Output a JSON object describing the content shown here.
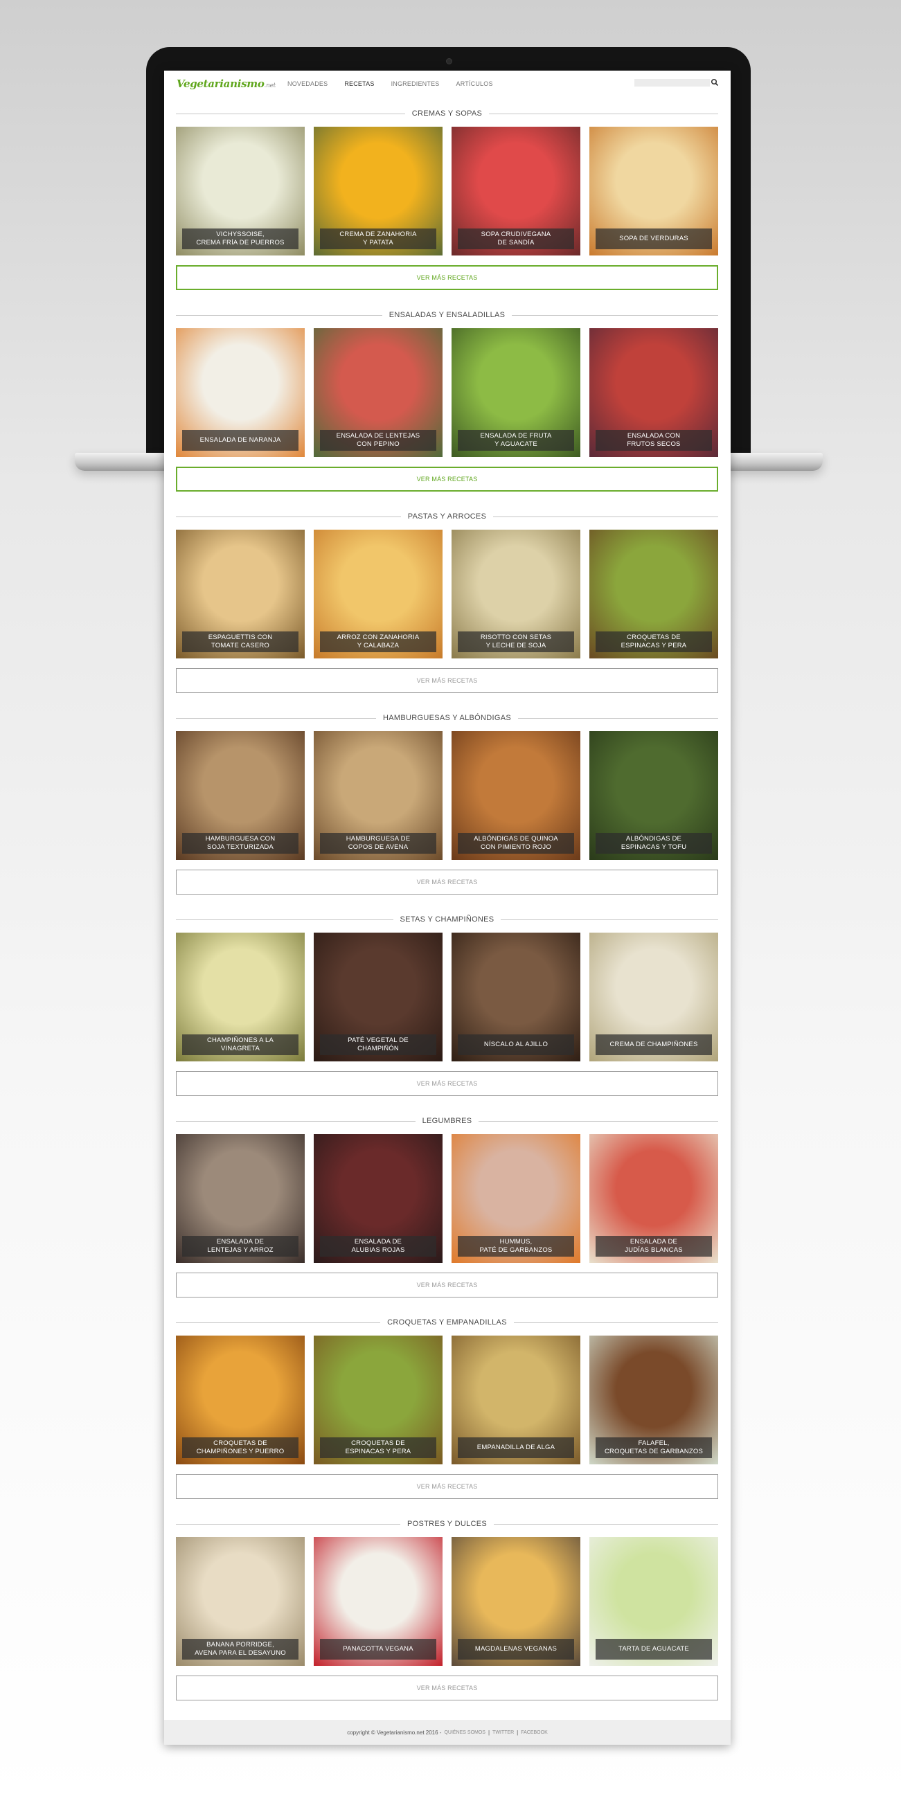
{
  "site": {
    "logo": "Vegetarianismo",
    "logo_suffix": ".net"
  },
  "nav": [
    {
      "label": "Novedades"
    },
    {
      "label": "Recetas"
    },
    {
      "label": "Ingredientes"
    },
    {
      "label": "Artículos"
    }
  ],
  "search": {
    "placeholder": ""
  },
  "more_label": "Ver más recetas",
  "sections": [
    {
      "title": "Cremas y sopas",
      "recipes": [
        {
          "name": "Vichyssoise,\ncrema fría de puerros",
          "c1": "#e9ead6",
          "c2": "#8f8c62"
        },
        {
          "name": "Crema de zanahoria\ny patata",
          "c1": "#f2b21e",
          "c2": "#5c6b34"
        },
        {
          "name": "Sopa crudivegana\nde sandía",
          "c1": "#e04a4a",
          "c2": "#6a2a2a"
        },
        {
          "name": "Sopa de verduras",
          "c1": "#f0d7a0",
          "c2": "#c97a2e"
        }
      ]
    },
    {
      "title": "Ensaladas y ensaladillas",
      "recipes": [
        {
          "name": "Ensalada de naranja",
          "c1": "#f2efe6",
          "c2": "#e0873a"
        },
        {
          "name": "Ensalada de lentejas\ncon pepino",
          "c1": "#d45a4e",
          "c2": "#4f6b3a"
        },
        {
          "name": "Ensalada de fruta\ny aguacate",
          "c1": "#8dbb45",
          "c2": "#3d5a22"
        },
        {
          "name": "Ensalada con\nfrutos secos",
          "c1": "#c0413a",
          "c2": "#5a2a38"
        }
      ]
    },
    {
      "title": "Pastas y arroces",
      "recipes": [
        {
          "name": "Espaguettis con\ntomate casero",
          "c1": "#e6c58a",
          "c2": "#7a5a2a"
        },
        {
          "name": "Arroz con zanahoria\ny calabaza",
          "c1": "#f1c66a",
          "c2": "#c77a2a"
        },
        {
          "name": "Risotto con setas\ny leche de soja",
          "c1": "#ddd1a8",
          "c2": "#8a7a4a"
        },
        {
          "name": "Croquetas de\nespinacas y pera",
          "c1": "#8ba63c",
          "c2": "#6a4a22"
        }
      ]
    },
    {
      "title": "Hamburguesas y albóndigas",
      "recipes": [
        {
          "name": "Hamburguesa con\nsoja texturizada",
          "c1": "#b7946a",
          "c2": "#5a3a22"
        },
        {
          "name": "Hamburguesa de\ncopos de avena",
          "c1": "#c9a878",
          "c2": "#6b4a2a"
        },
        {
          "name": "Albóndigas de quinoa\ncon pimiento rojo",
          "c1": "#c27a3a",
          "c2": "#6a3a1a"
        },
        {
          "name": "Albóndigas de\nespinacas y tofu",
          "c1": "#4f6b2f",
          "c2": "#2a3a1a"
        }
      ]
    },
    {
      "title": "Setas y champiñones",
      "recipes": [
        {
          "name": "Champiñones a la\nvinagreta",
          "c1": "#e4e0a6",
          "c2": "#7a7a3a"
        },
        {
          "name": "Paté vegetal de\nchampiñón",
          "c1": "#5a3a2e",
          "c2": "#2a1a14"
        },
        {
          "name": "Níscalo al ajillo",
          "c1": "#7a5a42",
          "c2": "#2e1e14"
        },
        {
          "name": "Crema de champiñones",
          "c1": "#e8e2cf",
          "c2": "#b0a47a"
        }
      ]
    },
    {
      "title": "Legumbres",
      "recipes": [
        {
          "name": "Ensalada de\nlentejas y arroz",
          "c1": "#9c8a7a",
          "c2": "#3a2e2a"
        },
        {
          "name": "Ensalada de\nalubias rojas",
          "c1": "#6a2a2a",
          "c2": "#2a1a1a"
        },
        {
          "name": "Hummus,\npaté de garbanzos",
          "c1": "#d9b3a1",
          "c2": "#e07a2a"
        },
        {
          "name": "Ensalada de\njudías blancas",
          "c1": "#d75a4a",
          "c2": "#e8e0cc"
        }
      ]
    },
    {
      "title": "Croquetas y empanadillas",
      "recipes": [
        {
          "name": "Croquetas de\nchampiñones y puerro",
          "c1": "#e8a33a",
          "c2": "#8a4a12"
        },
        {
          "name": "Croquetas de\nespinacas y pera",
          "c1": "#8ba63c",
          "c2": "#7a5a22"
        },
        {
          "name": "Empanadilla de alga",
          "c1": "#d2b56a",
          "c2": "#7a5a2a"
        },
        {
          "name": "Falafel,\ncroquetas de garbanzos",
          "c1": "#7a4a2a",
          "c2": "#cfd8c8"
        }
      ]
    },
    {
      "title": "Postres y dulces",
      "recipes": [
        {
          "name": "Banana porridge,\navena para el desayuno",
          "c1": "#e8dcc4",
          "c2": "#9a8a6a"
        },
        {
          "name": "Panacotta vegana",
          "c1": "#f2efe8",
          "c2": "#c2202a"
        },
        {
          "name": "Magdalenas veganas",
          "c1": "#e8b85a",
          "c2": "#5a4a3a"
        },
        {
          "name": "Tarta de aguacate",
          "c1": "#cfe3a0",
          "c2": "#eef0ea"
        }
      ]
    }
  ],
  "footer": {
    "copyright": "copyright © Vegetarianismo.net 2016 -",
    "links": [
      "Quiénes somos",
      "Twitter",
      "Facebook"
    ],
    "sep": "|"
  },
  "colors": {
    "brand_green": "#5fa61c",
    "laptop_bezel": "#141414"
  }
}
